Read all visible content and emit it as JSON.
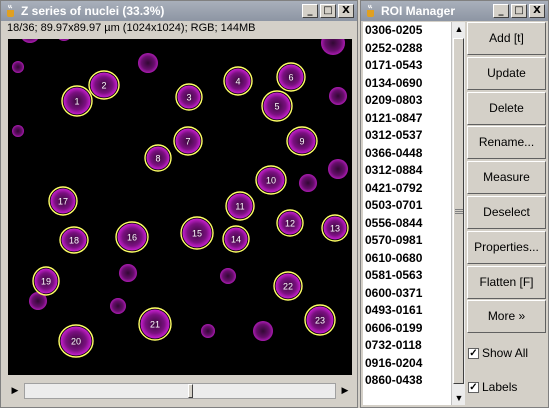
{
  "image_window": {
    "title": "Z series of nuclei (33.3%)",
    "info": "18/36; 89.97x89.97 µm (1024x1024); RGB; 144MB",
    "controls": {
      "minimize": "_",
      "maximize": "□",
      "close": "X"
    },
    "scroll_arrows": {
      "left": "▶",
      "right": "▶"
    },
    "roi_labels": [
      "1",
      "2",
      "3",
      "4",
      "5",
      "6",
      "7",
      "8",
      "9",
      "10",
      "11",
      "12",
      "13",
      "14",
      "15",
      "16",
      "17",
      "18",
      "19",
      "20",
      "21",
      "22",
      "23"
    ]
  },
  "roi_manager": {
    "title": "ROI Manager",
    "controls": {
      "minimize": "_",
      "maximize": "□",
      "close": "X"
    },
    "items": [
      "0306-0205",
      "0252-0288",
      "0171-0543",
      "0134-0690",
      "0209-0803",
      "0121-0847",
      "0312-0537",
      "0366-0448",
      "0312-0884",
      "0421-0792",
      "0503-0701",
      "0556-0844",
      "0570-0981",
      "0610-0680",
      "0581-0563",
      "0600-0371",
      "0493-0161",
      "0606-0199",
      "0732-0118",
      "0916-0204",
      "0860-0438"
    ],
    "buttons": [
      "Add [t]",
      "Update",
      "Delete",
      "Rename...",
      "Measure",
      "Deselect",
      "Properties...",
      "Flatten [F]",
      "More »"
    ],
    "checkboxes": [
      {
        "label": "Show All",
        "checked": true
      },
      {
        "label": "Labels",
        "checked": true
      }
    ],
    "scroll_arrows": {
      "up": "▲",
      "down": "▼"
    }
  },
  "colors": {
    "outline": "#ffff66",
    "nucleus": "#c018c8",
    "background": "#000000"
  }
}
